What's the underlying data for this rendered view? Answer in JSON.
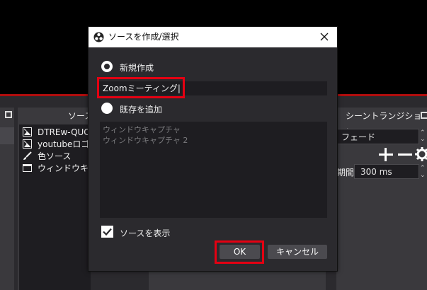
{
  "background": {
    "sources_dock": {
      "title": "ソース",
      "items": [
        {
          "label": "DTREw-QUC",
          "icon": "image-icon"
        },
        {
          "label": "youtubeロゴデ",
          "icon": "image-icon"
        },
        {
          "label": "色ソース",
          "icon": "brush-icon"
        },
        {
          "label": "ウィンドウキャプ",
          "icon": "window-icon"
        }
      ]
    },
    "transitions_dock": {
      "title": "シーントランジション",
      "transition_value": "フェード",
      "add_label": "+",
      "remove_label": "−",
      "duration_label": "期間",
      "duration_value": "300 ms"
    }
  },
  "dialog": {
    "title": "ソースを作成/選択",
    "create_new_label": "新規作成",
    "name_value": "Zoomミーティング|",
    "add_existing_label": "既存を追加",
    "existing_items": [
      "ウィンドウキャプチャ",
      "ウィンドウキャプチャ 2"
    ],
    "show_source_label": "ソースを表示",
    "ok_label": "OK",
    "cancel_label": "キャンセル"
  },
  "colors": {
    "highlight": "#e50012",
    "accent_bar": "#b00d0d"
  }
}
